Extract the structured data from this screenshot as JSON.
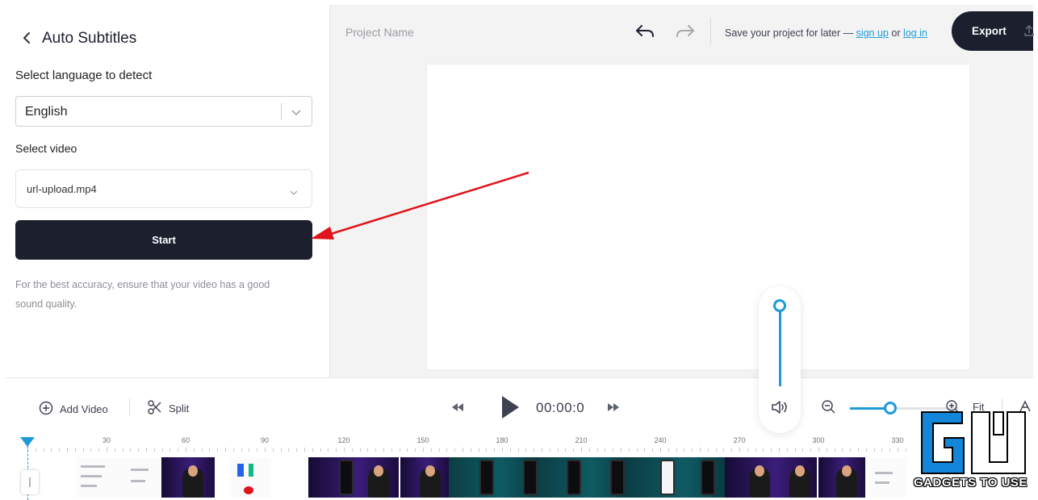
{
  "panel": {
    "title": "Auto Subtitles",
    "language_label": "Select language to detect",
    "language_value": "English",
    "video_label": "Select video",
    "video_value": "url-upload.mp4",
    "start_label": "Start",
    "hint": "For the best accuracy, ensure that your video has a good sound quality."
  },
  "topbar": {
    "project_name": "Project Name",
    "save_prefix": "Save your project for later — ",
    "sign_up": "sign up",
    "or": " or ",
    "log_in": "log in",
    "export_label": "Export"
  },
  "toolbar": {
    "add_video": "Add Video",
    "split": "Split",
    "time": "00:00:0",
    "fit": "Fit",
    "zoom_level": 0.37
  },
  "volume": {
    "level": 1.0
  },
  "timeline": {
    "ticks": [
      "30",
      "60",
      "90",
      "120",
      "150",
      "180",
      "210",
      "240",
      "270",
      "300",
      "330"
    ]
  },
  "watermark": {
    "text": "GADGETS TO USE"
  },
  "colors": {
    "dark": "#1b1f2e",
    "accent": "#1e9bd7",
    "annotation_arrow": "#e0141b"
  },
  "icons": {
    "back": "chevron-left-icon",
    "undo": "undo-arrow-icon",
    "redo": "redo-arrow-icon",
    "export": "upload-icon",
    "add_video": "plus-circle-icon",
    "split": "scissors-icon",
    "volume": "speaker-icon"
  }
}
